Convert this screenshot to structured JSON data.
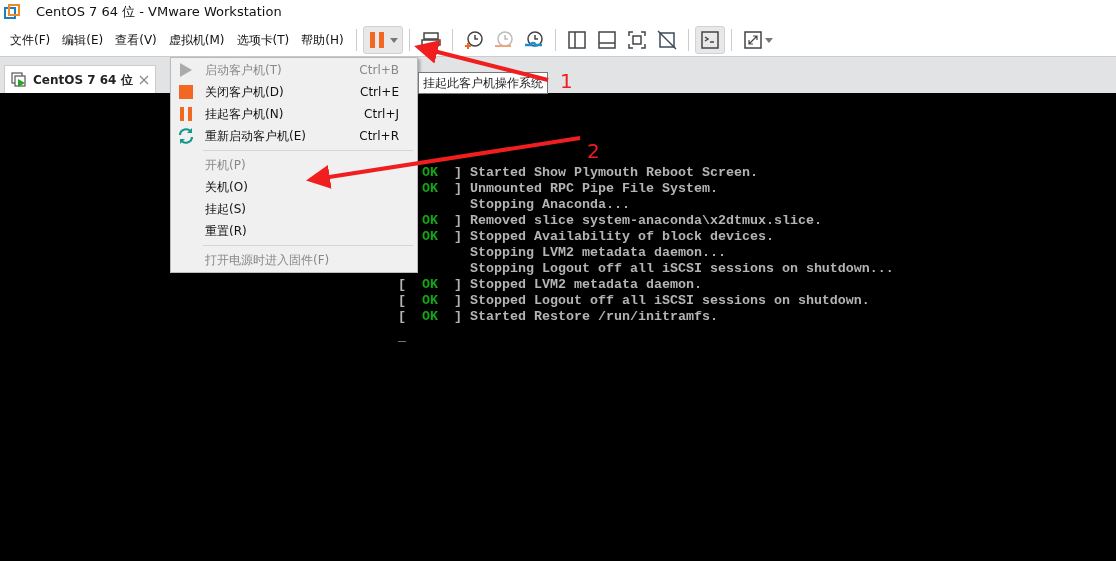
{
  "window": {
    "title": "CentOS 7 64 位 - VMware Workstation"
  },
  "menubar": [
    "文件(F)",
    "编辑(E)",
    "查看(V)",
    "虚拟机(M)",
    "选项卡(T)",
    "帮助(H)"
  ],
  "toolbar": [
    {
      "kind": "separator"
    },
    {
      "kind": "pause",
      "pressed": true
    },
    {
      "kind": "separator"
    },
    {
      "kind": "send-keys",
      "pressed": false
    },
    {
      "kind": "separator"
    },
    {
      "kind": "snapshot-take",
      "pressed": false
    },
    {
      "kind": "snapshot-revert",
      "pressed": false
    },
    {
      "kind": "snapshot-manage",
      "pressed": false
    },
    {
      "kind": "separator"
    },
    {
      "kind": "view-library",
      "pressed": false
    },
    {
      "kind": "view-thumbs",
      "pressed": false
    },
    {
      "kind": "view-full",
      "pressed": false
    },
    {
      "kind": "view-unity",
      "pressed": false
    },
    {
      "kind": "separator"
    },
    {
      "kind": "console",
      "pressed": true
    },
    {
      "kind": "separator"
    },
    {
      "kind": "stretch",
      "pressed": false
    }
  ],
  "tabs": [
    {
      "label": "CentOS 7 64 位",
      "selected": true
    }
  ],
  "menu": [
    {
      "kind": "start",
      "label": "启动客户机(T)",
      "shortcut": "Ctrl+B",
      "disabled": true
    },
    {
      "kind": "stop",
      "label": "关闭客户机(D)",
      "shortcut": "Ctrl+E",
      "disabled": false
    },
    {
      "kind": "suspend",
      "label": "挂起客户机(N)",
      "shortcut": "Ctrl+J",
      "disabled": false
    },
    {
      "kind": "restart",
      "label": "重新启动客户机(E)",
      "shortcut": "Ctrl+R",
      "disabled": false
    },
    {
      "kind": "separator"
    },
    {
      "kind": "item",
      "label": "开机(P)",
      "disabled": true
    },
    {
      "kind": "item",
      "label": "关机(O)",
      "disabled": false
    },
    {
      "kind": "item",
      "label": "挂起(S)",
      "disabled": false
    },
    {
      "kind": "item",
      "label": "重置(R)",
      "disabled": false
    },
    {
      "kind": "separator"
    },
    {
      "kind": "item",
      "label": "打开电源时进入固件(F)",
      "disabled": true
    }
  ],
  "tooltip": "挂起此客户机操作系统",
  "console": {
    "lines": [
      {
        "status": "OK",
        "close": "]",
        "text": "Started Show Plymouth Reboot Screen."
      },
      {
        "status": "OK",
        "close": "]",
        "text": "Unmounted RPC Pipe File System."
      },
      {
        "text": "Stopping Anaconda..."
      },
      {
        "status": "OK",
        "close": "]",
        "text": "Removed slice system-anaconda\\x2dtmux.slice."
      },
      {
        "status": "OK",
        "close": "]",
        "text": "Stopped Availability of block devices."
      },
      {
        "text": "Stopping LVM2 metadata daemon..."
      },
      {
        "text": "Stopping Logout off all iSCSI sessions on shutdown..."
      },
      {
        "open": "[",
        "status": "OK",
        "close": "]",
        "text": "Stopped LVM2 metadata daemon."
      },
      {
        "open": "[",
        "status": "OK",
        "close": "]",
        "text": "Stopped Logout off all iSCSI sessions on shutdown."
      },
      {
        "open": "[",
        "status": "OK",
        "close": "]",
        "text": "Started Restore /run/initramfs."
      }
    ],
    "cursor": "_"
  },
  "annotations": [
    {
      "label": "1"
    },
    {
      "label": "2"
    }
  ]
}
